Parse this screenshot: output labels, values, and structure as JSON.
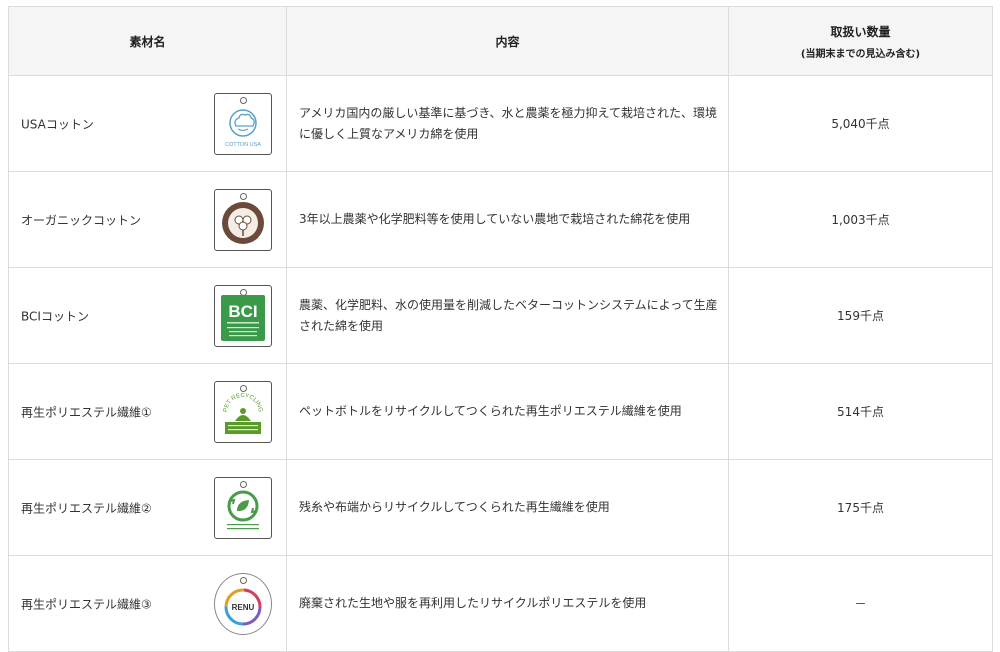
{
  "headers": {
    "material": "素材名",
    "content": "内容",
    "quantity": "取扱い数量",
    "quantity_note": "(当期末までの見込み含む)"
  },
  "rows": [
    {
      "name": "USAコットン",
      "icon": "cotton-usa-tag-icon",
      "icon_text": "COTTON USA",
      "content": "アメリカ国内の厳しい基準に基づき、水と農薬を極力抑えて栽培された、環境に優しく上質なアメリカ綿を使用",
      "quantity": "5,040千点"
    },
    {
      "name": "オーガニックコットン",
      "icon": "organic-cotton-tag-icon",
      "icon_text": "",
      "content": "3年以上農薬や化学肥料等を使用していない農地で栽培された綿花を使用",
      "quantity": "1,003千点"
    },
    {
      "name": "BCIコットン",
      "icon": "bci-tag-icon",
      "icon_text": "BCI",
      "content": "農薬、化学肥料、水の使用量を削減したベターコットンシステムによって生産された綿を使用",
      "quantity": "159千点"
    },
    {
      "name": "再生ポリエステル繊維①",
      "icon": "pet-recycling-tag-icon",
      "icon_text": "PET RECYCLING",
      "content": "ペットボトルをリサイクルしてつくられた再生ポリエステル繊維を使用",
      "quantity": "514千点"
    },
    {
      "name": "再生ポリエステル繊維②",
      "icon": "recycle-leaf-tag-icon",
      "icon_text": "",
      "content": "残糸や布端からリサイクルしてつくられた再生繊維を使用",
      "quantity": "175千点"
    },
    {
      "name": "再生ポリエステル繊維③",
      "icon": "renu-tag-icon",
      "icon_text": "RENU",
      "content": "廃棄された生地や服を再利用したリサイクルポリエステルを使用",
      "quantity": "－"
    }
  ],
  "colors": {
    "header_bg": "#f5f5f5",
    "border": "#dcdcdc",
    "cotton_blue": "#5aa0c8",
    "organic_brown": "#6b4a3a",
    "bci_green": "#3a9a4a",
    "pet_green": "#5a9a2a",
    "recycle_green": "#4a9a4a"
  }
}
